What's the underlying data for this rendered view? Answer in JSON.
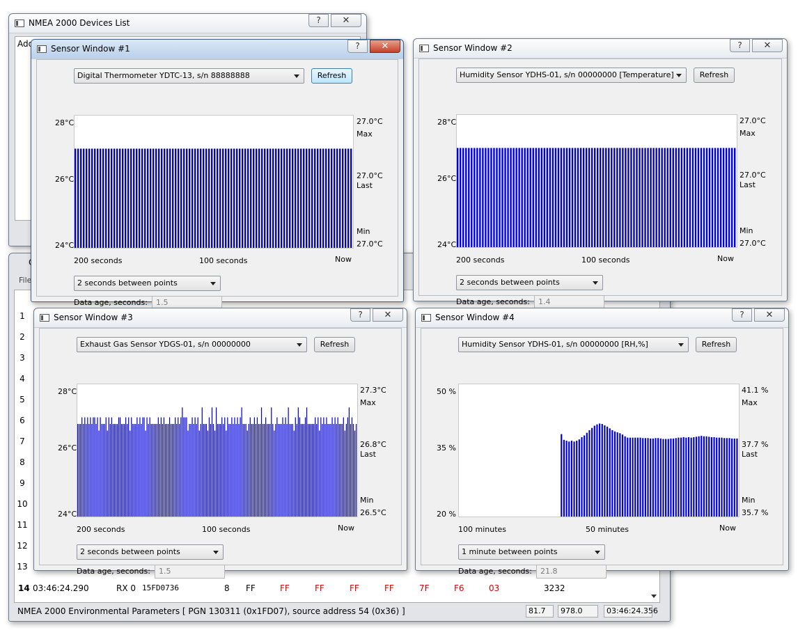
{
  "devices_window": {
    "title": "NMEA 2000 Devices List",
    "help": "?",
    "close": "✕",
    "partial_header": "Add"
  },
  "main_window": {
    "partial_title": "C",
    "partial_menu": "File",
    "row_numbers": [
      "1",
      "2",
      "3",
      "4",
      "5",
      "6",
      "7",
      "8",
      "9",
      "10",
      "11",
      "12",
      "13"
    ],
    "row_last": {
      "num": "14",
      "time": "03:46:24.290",
      "dir": "RX 0",
      "can_id": "15FD0736",
      "len": "8",
      "bytes": [
        "FF",
        "FF",
        "FF",
        "FF",
        "FF",
        "7F",
        "F6",
        "03"
      ],
      "value": "3232"
    },
    "status": {
      "text": "NMEA 2000 Environmental Parameters [ PGN 130311 (0x1FD07), source address 54 (0x36) ]",
      "f1": "81.7",
      "f2": "978.0",
      "f3": "03:46:24.356"
    },
    "colors": {
      "red_byte": "#e00000"
    }
  },
  "sensor_windows": [
    {
      "title": "Sensor Window #1",
      "device": "Digital Thermometer YDTC-13, s/n 88888888",
      "refresh": "Refresh",
      "y_top": "28°C",
      "y_mid": "26°C",
      "y_bot": "24°C",
      "max_val": "27.0°C",
      "max_lbl": "Max",
      "last_val": "27.0°C",
      "last_lbl": "Last",
      "min_lbl": "Min",
      "min_val": "27.0°C",
      "x_left": "200 seconds",
      "x_mid": "100 seconds",
      "x_right": "Now",
      "interval": "2 seconds between points",
      "age_label": "Data age, seconds:",
      "age_value": "1.5"
    },
    {
      "title": "Sensor Window #2",
      "device": "Humidity Sensor YDHS-01, s/n 00000000 [Temperature]",
      "refresh": "Refresh",
      "y_top": "28°C",
      "y_mid": "26°C",
      "y_bot": "24°C",
      "max_val": "27.0°C",
      "max_lbl": "Max",
      "last_val": "27.0°C",
      "last_lbl": "Last",
      "min_lbl": "Min",
      "min_val": "27.0°C",
      "x_left": "200 seconds",
      "x_mid": "100 seconds",
      "x_right": "Now",
      "interval": "2 seconds between points",
      "age_label": "Data age, seconds:",
      "age_value": "1.4"
    },
    {
      "title": "Sensor Window #3",
      "device": "Exhaust Gas Sensor YDGS-01, s/n 00000000",
      "refresh": "Refresh",
      "y_top": "28°C",
      "y_mid": "26°C",
      "y_bot": "24°C",
      "max_val": "27.3°C",
      "max_lbl": "Max",
      "last_val": "26.8°C",
      "last_lbl": "Last",
      "min_lbl": "Min",
      "min_val": "26.5°C",
      "x_left": "200 seconds",
      "x_mid": "100 seconds",
      "x_right": "Now",
      "interval": "2 seconds between points",
      "age_label": "Data age, seconds:",
      "age_value": "1.5"
    },
    {
      "title": "Sensor Window #4",
      "device": "Humidity Sensor YDHS-01, s/n 00000000 [RH,%]",
      "refresh": "Refresh",
      "y_top": "50 %",
      "y_mid": "35 %",
      "y_bot": "20 %",
      "max_val": "41.1 %",
      "max_lbl": "Max",
      "last_val": "37.7 %",
      "last_lbl": "Last",
      "min_lbl": "Min",
      "min_val": "35.7 %",
      "x_left": "100 minutes",
      "x_mid": "50 minutes",
      "x_right": "Now",
      "interval": "1 minute between points",
      "age_label": "Data age, seconds:",
      "age_value": "21.8"
    }
  ],
  "chart_data": [
    {
      "type": "bar",
      "ylim": [
        24,
        28
      ],
      "values": [
        27.0,
        27.0,
        27.0,
        27.0,
        27.0,
        27.0,
        27.0,
        27.0,
        27.0,
        27.0,
        27.0,
        27.0,
        27.0,
        27.0,
        27.0,
        27.0,
        27.0,
        27.0,
        27.0,
        27.0,
        27.0,
        27.0,
        27.0,
        27.0,
        27.0,
        27.0,
        27.0,
        27.0,
        27.0,
        27.0,
        27.0,
        27.0,
        27.0,
        27.0,
        27.0,
        27.0,
        27.0,
        27.0,
        27.0,
        27.0,
        27.0,
        27.0,
        27.0,
        27.0,
        27.0,
        27.0,
        27.0,
        27.0,
        27.0,
        27.0,
        27.0,
        27.0,
        27.0,
        27.0,
        27.0,
        27.0,
        27.0,
        27.0,
        27.0,
        27.0,
        27.0,
        27.0,
        27.0,
        27.0,
        27.0,
        27.0,
        27.0,
        27.0,
        27.0,
        27.0,
        27.0,
        27.0,
        27.0,
        27.0,
        27.0,
        27.0,
        27.0,
        27.0,
        27.0,
        27.0,
        27.0,
        27.0,
        27.0,
        27.0,
        27.0,
        27.0,
        27.0,
        27.0,
        27.0,
        27.0,
        27.0,
        27.0,
        27.0,
        27.0,
        27.0,
        27.0,
        27.0,
        27.0,
        27.0,
        27.0
      ],
      "bar_color": "#0000dd"
    },
    {
      "type": "bar",
      "ylim": [
        24,
        28
      ],
      "values": [
        27.0,
        27.0,
        27.0,
        27.0,
        27.0,
        27.0,
        27.0,
        27.0,
        27.0,
        27.0,
        27.0,
        27.0,
        27.0,
        27.0,
        27.0,
        27.0,
        27.0,
        27.0,
        27.0,
        27.0,
        27.0,
        27.0,
        27.0,
        27.0,
        27.0,
        27.0,
        27.0,
        27.0,
        27.0,
        27.0,
        27.0,
        27.0,
        27.0,
        27.0,
        27.0,
        27.0,
        27.0,
        27.0,
        27.0,
        27.0,
        27.0,
        27.0,
        27.0,
        27.0,
        27.0,
        27.0,
        27.0,
        27.0,
        27.0,
        27.0,
        27.0,
        27.0,
        27.0,
        27.0,
        27.0,
        27.0,
        27.0,
        27.0,
        27.0,
        27.0,
        27.0,
        27.0,
        27.0,
        27.0,
        27.0,
        27.0,
        27.0,
        27.0,
        27.0,
        27.0,
        27.0,
        27.0,
        27.0,
        27.0,
        27.0,
        27.0,
        27.0,
        27.0,
        27.0,
        27.0,
        27.0,
        27.0,
        27.0,
        27.0,
        27.0,
        27.0,
        27.0,
        27.0,
        27.0,
        27.0,
        27.0,
        27.0,
        27.0,
        27.0,
        27.0,
        27.0,
        27.0,
        27.0,
        27.0,
        27.0
      ],
      "bar_color": "#0000dd"
    },
    {
      "type": "bar",
      "ylim": [
        24,
        28
      ],
      "values": [
        26.8,
        26.8,
        26.8,
        27.0,
        26.8,
        27.0,
        26.8,
        27.0,
        26.8,
        27.0,
        26.8,
        27.0,
        27.0,
        26.8,
        27.0,
        26.6,
        27.0,
        26.8,
        26.8,
        26.8,
        27.0,
        26.6,
        27.0,
        26.8,
        27.0,
        26.8,
        26.8,
        26.8,
        26.8,
        27.0,
        27.0,
        26.8,
        26.8,
        26.8,
        27.0,
        26.8,
        27.0,
        26.6,
        27.0,
        26.8,
        26.8,
        26.8,
        27.0,
        26.8,
        27.0,
        26.8,
        27.0,
        27.0,
        26.6,
        27.0,
        26.8,
        27.0,
        26.8,
        26.8,
        26.8,
        26.8,
        26.8,
        27.0,
        26.8,
        27.0,
        26.8,
        27.0,
        26.8,
        26.8,
        26.8,
        27.0,
        26.8,
        26.8,
        26.8,
        27.0,
        26.8,
        27.0,
        26.8,
        27.0,
        27.3,
        27.0,
        27.0,
        27.0,
        26.6,
        26.8,
        26.8,
        27.0,
        26.8,
        27.0,
        26.8,
        27.0,
        26.6,
        26.8,
        27.3,
        26.8,
        26.8,
        26.8,
        26.6,
        27.0,
        26.8,
        27.3,
        26.8,
        26.6,
        27.3,
        26.8,
        26.8,
        26.8,
        27.0,
        26.8,
        27.0,
        26.6,
        27.0,
        26.8,
        26.8,
        27.0,
        26.8,
        27.0,
        26.8,
        27.0,
        26.8,
        27.0,
        27.3,
        26.8,
        26.8,
        26.8,
        26.6,
        26.8,
        27.0,
        26.8,
        26.8,
        27.0,
        26.8,
        27.0,
        26.8,
        26.8,
        27.3,
        26.8,
        26.8,
        27.0,
        26.8,
        26.8,
        26.8,
        27.3,
        26.8,
        26.6,
        26.8,
        27.0,
        26.8,
        26.8,
        26.8,
        27.0,
        26.8,
        27.0,
        26.8,
        27.3,
        26.8,
        26.8,
        26.8,
        26.6,
        27.0,
        26.8,
        27.3,
        27.0,
        26.8,
        26.8,
        26.8,
        27.0,
        27.3,
        26.8,
        26.8,
        26.8,
        26.8,
        26.8,
        27.0,
        26.8,
        27.0,
        26.6,
        27.0,
        26.8,
        27.0,
        26.8,
        27.0,
        26.8,
        26.8,
        26.8,
        27.0,
        26.8,
        27.0,
        26.8,
        27.0,
        26.8,
        26.8,
        26.8,
        27.0,
        26.6,
        26.8,
        27.0,
        27.3,
        26.8,
        27.0,
        26.8,
        26.6,
        26.8
      ],
      "bar_color": "#0000dd"
    },
    {
      "type": "bar",
      "ylim": [
        20,
        50
      ],
      "values": [
        0,
        0,
        0,
        0,
        0,
        0,
        0,
        0,
        0,
        0,
        0,
        0,
        0,
        0,
        0,
        0,
        0,
        0,
        0,
        0,
        0,
        0,
        0,
        0,
        0,
        0,
        0,
        0,
        0,
        0,
        0,
        0,
        0,
        0,
        0,
        0,
        0,
        0,
        0,
        0,
        38.7,
        37.4,
        37.2,
        37.0,
        37.2,
        37.0,
        37.2,
        37.5,
        38.0,
        38.4,
        39.0,
        39.6,
        40.1,
        40.6,
        40.9,
        41.1,
        41.0,
        40.7,
        40.4,
        40.0,
        39.6,
        39.3,
        39.1,
        38.9,
        38.6,
        38.2,
        37.9,
        37.9,
        37.9,
        37.9,
        37.9,
        37.9,
        37.8,
        37.8,
        37.8,
        37.7,
        37.7,
        37.8,
        37.8,
        37.7,
        37.6,
        37.6,
        37.6,
        37.7,
        37.7,
        37.8,
        37.9,
        37.9,
        38.0,
        37.9,
        38.0,
        37.9,
        38.0,
        38.1,
        38.2,
        38.3,
        38.2,
        38.2,
        38.1,
        38.0,
        38.0,
        37.9,
        37.9,
        37.9,
        37.8,
        37.8,
        37.8,
        37.7,
        37.7,
        37.7
      ],
      "bar_color": "#0000dd"
    }
  ]
}
